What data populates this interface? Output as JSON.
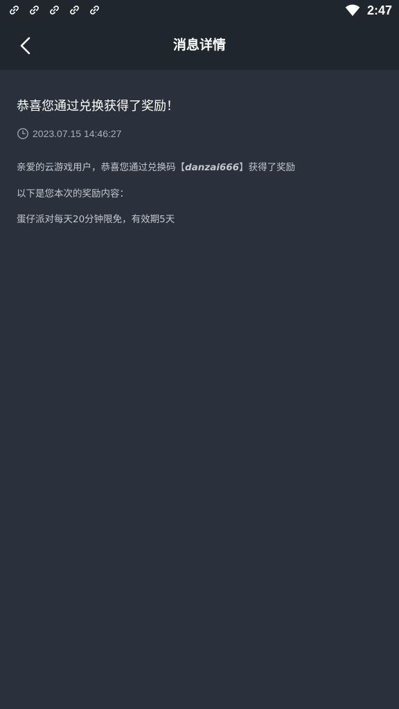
{
  "status_bar": {
    "notification_icons": [
      "link-icon",
      "link-icon",
      "link-icon",
      "link-icon",
      "link-icon"
    ],
    "wifi": "wifi-icon",
    "time": "2:47"
  },
  "header": {
    "back_icon": "chevron-left-icon",
    "title": "消息详情"
  },
  "message": {
    "title": "恭喜您通过兑换获得了奖励！",
    "time_icon": "clock-icon",
    "timestamp": "2023.07.15 14:46:27",
    "line1_prefix": "亲爱的云游戏用户，恭喜您通过兑换码【",
    "redeem_code": "danzai666",
    "line1_suffix": "】获得了奖励",
    "line2": "以下是您本次的奖励内容：",
    "line3": "蛋仔派对每天20分钟限免，有效期5天"
  },
  "colors": {
    "background": "#2a313c",
    "header_background": "#20262e",
    "title_text": "#ffffff",
    "body_text": "#c3c8cf",
    "meta_text": "#a8b0bb"
  }
}
